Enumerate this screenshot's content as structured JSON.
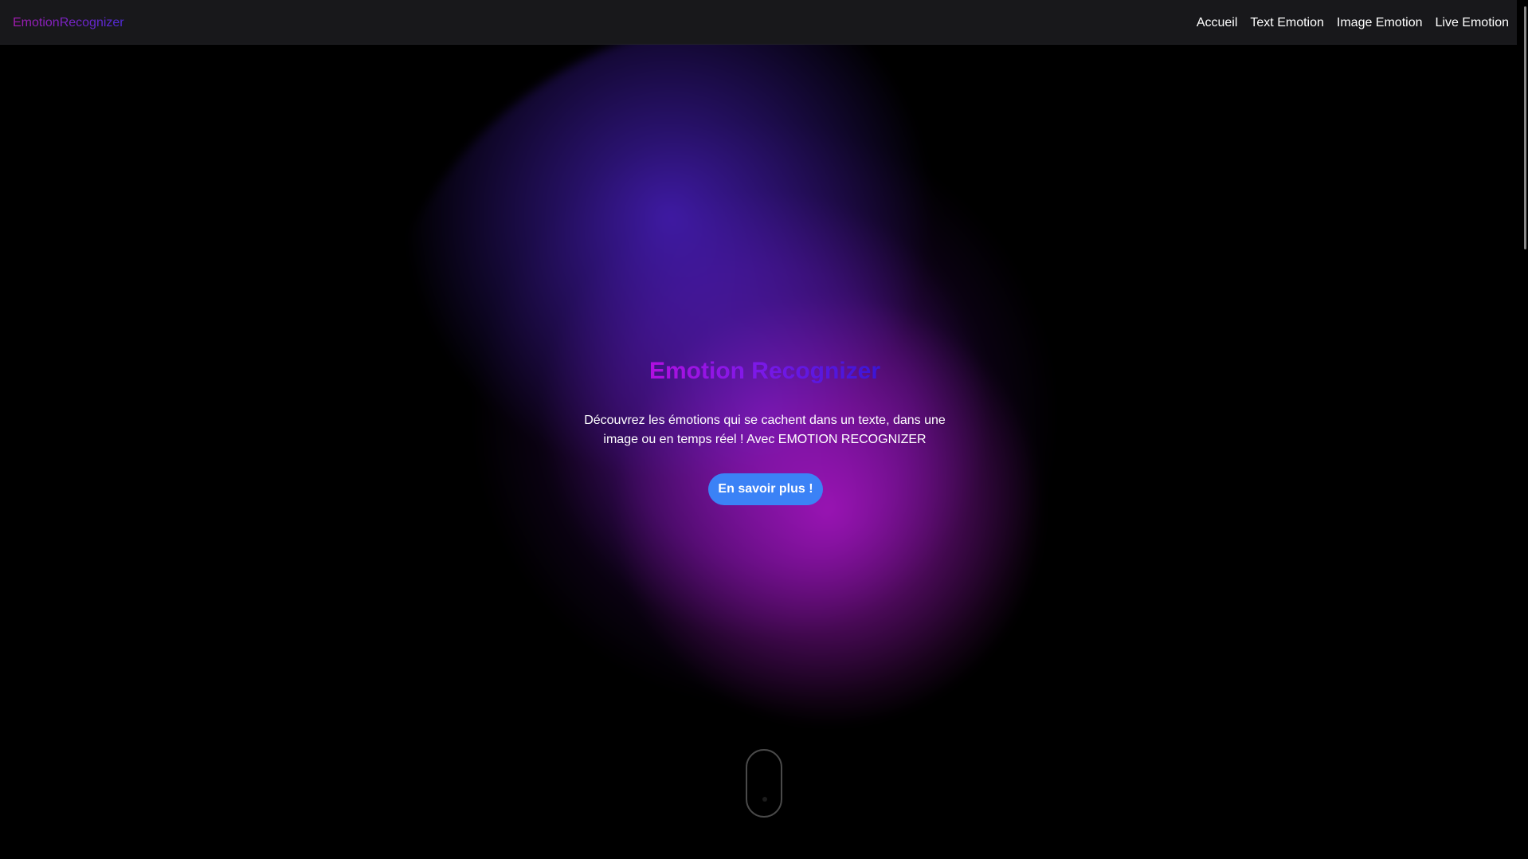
{
  "navbar": {
    "brand": "EmotionRecognizer",
    "links": [
      "Accueil",
      "Text Emotion",
      "Image Emotion",
      "Live Emotion"
    ]
  },
  "hero": {
    "title": "Emotion Recognizer",
    "description": "Découvrez les émotions qui se cachent dans un texte, dans une image ou en temps réel ! Avec EMOTION RECOGNIZER",
    "cta_label": "En savoir plus !"
  },
  "colors": {
    "background": "#000000",
    "navbar_bg": "#18181b",
    "brand_gradient_start": "#a21caf",
    "brand_gradient_end": "#4f2bd8",
    "cta_bg": "#3b82f6",
    "glow_violet": "#4f22d2",
    "glow_magenta": "#b016c7"
  },
  "icons": {
    "scroll_indicator": "mouse-scroll-icon"
  }
}
